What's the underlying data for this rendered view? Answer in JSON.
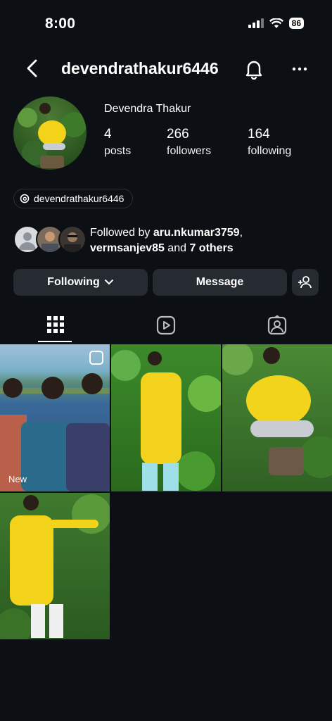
{
  "status_bar": {
    "time": "8:00",
    "battery": "86"
  },
  "header": {
    "username": "devendrathakur6446"
  },
  "profile": {
    "display_name": "Devendra Thakur",
    "stats": [
      {
        "value": "4",
        "label": "posts"
      },
      {
        "value": "266",
        "label": "followers"
      },
      {
        "value": "164",
        "label": "following"
      }
    ],
    "threads_handle": "devendrathakur6446"
  },
  "followed_by": {
    "prefix": "Followed by ",
    "user1": "aru.nkumar3759",
    "sep": ",",
    "user2": "vermsanjev85",
    "and": " and ",
    "others": "7 others"
  },
  "actions": {
    "following": "Following",
    "message": "Message"
  },
  "posts": [
    {
      "label": "New"
    },
    {
      "label": ""
    },
    {
      "label": ""
    },
    {
      "label": ""
    }
  ],
  "colors": {
    "background": "#0c0f14",
    "button": "#262a31",
    "text": "#ffffff"
  }
}
